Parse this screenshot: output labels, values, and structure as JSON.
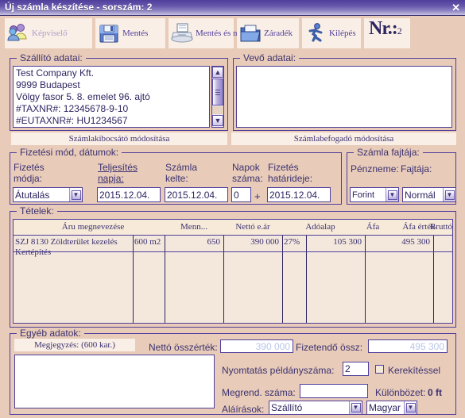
{
  "window": {
    "title": "Új számla készítése - sorszám: 2",
    "close_label": "✕"
  },
  "toolbar": {
    "buttons": [
      {
        "label": "Képviselő",
        "icon": "users-icon",
        "disabled": true
      },
      {
        "label": "Mentés",
        "icon": "floppy-disk-icon",
        "disabled": false
      },
      {
        "label": "Mentés és nyomtatás",
        "icon": "printer-icon",
        "disabled": false
      },
      {
        "label": "Záradék",
        "icon": "folder-icon",
        "disabled": false
      },
      {
        "label": "Kilépés",
        "icon": "running-person-icon",
        "disabled": false
      }
    ],
    "nr_prefix": "Nr.",
    "nr_colon": ":",
    "nr_value": "2"
  },
  "supplier": {
    "legend": "Szállító adatai:",
    "text": "Test Company Kft.\n9999 Budapest\nVölgy fasor 5. 8. emelet 96. ajtó\n#TAXNR#: 12345678-9-10\n#EUTAXNR#: HU1234567",
    "edit_button": "Számlakibocsátó módosítása"
  },
  "buyer": {
    "legend": "Vevő adatai:",
    "text": "",
    "edit_button": "Számlabefogadó módosítása"
  },
  "payment": {
    "legend": "Fizetési mód, dátumok:",
    "fields": [
      {
        "label_line1": "Fizetés",
        "label_line2": "módja:",
        "value": "Átutalás",
        "type": "combo",
        "underline": false
      },
      {
        "label_line1": "Teljesítés",
        "label_line2": "napja:",
        "value": "2015.12.04.",
        "type": "input",
        "underline": true
      },
      {
        "label_line1": "Számla",
        "label_line2": "kelte:",
        "value": "2015.12.04.",
        "type": "input",
        "underline": false
      },
      {
        "label_line1": "Napok",
        "label_line2": "száma:",
        "value": "0",
        "type": "input",
        "underline": false
      },
      {
        "label_line1": "Fizetés",
        "label_line2": "határideje:",
        "value": "2015.12.04.",
        "type": "input",
        "underline": false
      }
    ],
    "plus_sign": "+"
  },
  "invoice_type": {
    "legend": "Számla fajtája:",
    "currency_label": "Pénzneme:",
    "kind_label": "Fajtája:",
    "currency_value": "Forint",
    "kind_value": "Normál"
  },
  "items": {
    "legend": "Tételek:",
    "columns": [
      "Áru megnevezése",
      "Menn...",
      "Nettó e.ár",
      "Adóalap",
      "Áfa",
      "Áfa érték",
      "Bruttó"
    ],
    "rows": [
      {
        "name": "SZJ 8130 Zöldterület kezelés\nKertépítés",
        "quantity": "600 m2",
        "unit_net_price": "650",
        "tax_base": "390 000",
        "vat_rate": "27%",
        "vat_value": "105 300",
        "gross": "495 300"
      }
    ]
  },
  "other": {
    "legend": "Egyéb adatok:",
    "comment_label": "Megjegyzés: (600 kar.)",
    "comment_value": "",
    "net_total_label": "Nettó összérték:",
    "net_total_value": "390 000",
    "payable_label": "Fizetendő össz:",
    "payable_value": "495 300",
    "copies_label": "Nyomtatás példányszáma:",
    "copies_value": "2",
    "rounding_label": "Kerekítéssel",
    "rounding_checked": false,
    "order_no_label": "Megrend. száma:",
    "order_no_value": "",
    "difference_label": "Különbözet:",
    "difference_value": "0 ft",
    "signatures_label": "Aláírások:",
    "signature_value": "Szállító",
    "language_value": "Magyar"
  }
}
